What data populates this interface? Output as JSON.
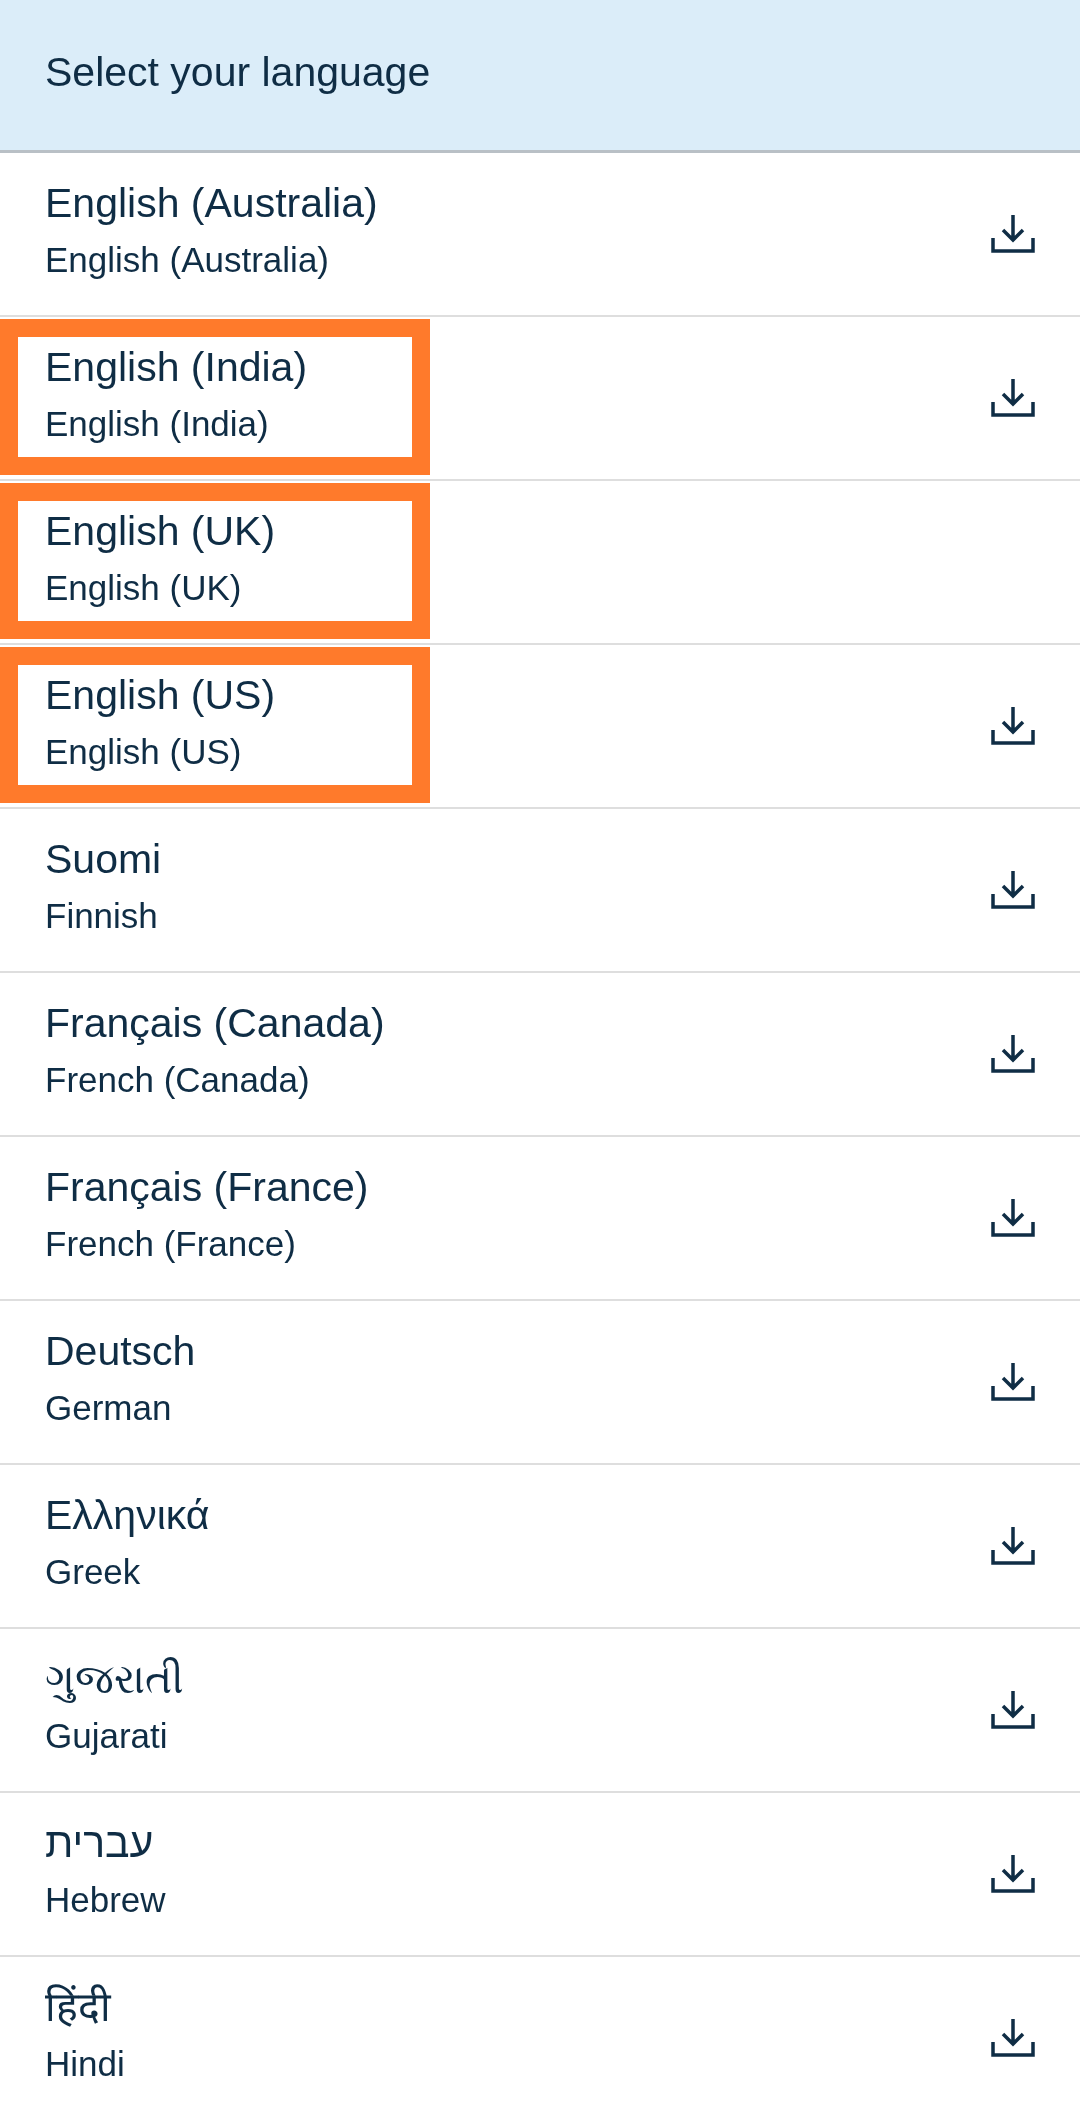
{
  "header": {
    "title": "Select your language"
  },
  "languages": [
    {
      "name": "English (Australia)",
      "english_name": "English (Australia)",
      "downloadable": true,
      "highlighted": false
    },
    {
      "name": "English (India)",
      "english_name": "English (India)",
      "downloadable": true,
      "highlighted": true
    },
    {
      "name": "English (UK)",
      "english_name": "English (UK)",
      "downloadable": false,
      "highlighted": true
    },
    {
      "name": "English (US)",
      "english_name": "English (US)",
      "downloadable": true,
      "highlighted": true
    },
    {
      "name": "Suomi",
      "english_name": "Finnish",
      "downloadable": true,
      "highlighted": false
    },
    {
      "name": "Français (Canada)",
      "english_name": "French (Canada)",
      "downloadable": true,
      "highlighted": false
    },
    {
      "name": "Français (France)",
      "english_name": "French (France)",
      "downloadable": true,
      "highlighted": false
    },
    {
      "name": "Deutsch",
      "english_name": "German",
      "downloadable": true,
      "highlighted": false
    },
    {
      "name": "Ελληνικά",
      "english_name": "Greek",
      "downloadable": true,
      "highlighted": false
    },
    {
      "name": "ગુજરાતી",
      "english_name": "Gujarati",
      "downloadable": true,
      "highlighted": false
    },
    {
      "name": "עברית",
      "english_name": "Hebrew",
      "downloadable": true,
      "highlighted": false
    },
    {
      "name": "हिंदी",
      "english_name": "Hindi",
      "downloadable": true,
      "highlighted": false
    }
  ]
}
